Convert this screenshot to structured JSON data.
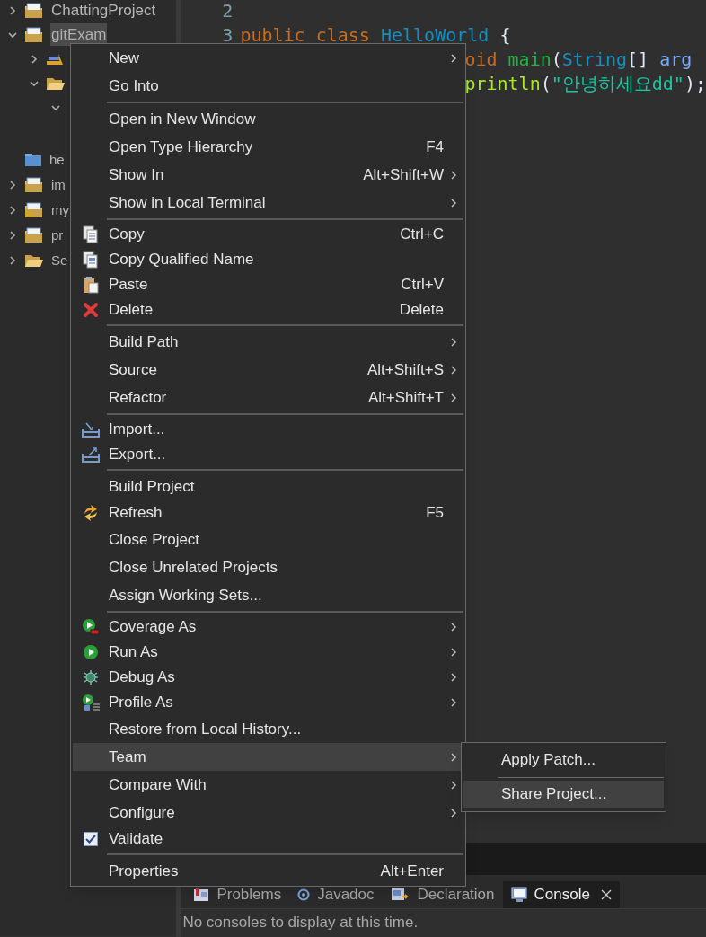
{
  "tree": [
    {
      "label": "ChattingProject",
      "kind": "project",
      "expanded": false,
      "selected": false
    },
    {
      "label": "gitExam",
      "kind": "project",
      "expanded": true,
      "selected": true,
      "children": [
        {
          "kind": "library",
          "expanded": false
        },
        {
          "kind": "folder",
          "expanded": true,
          "children": [
            {
              "expanded": true
            }
          ]
        }
      ]
    },
    {
      "label": "he",
      "kind": "box",
      "selected": false
    },
    {
      "label": "im",
      "kind": "project",
      "expanded": false,
      "selected": false
    },
    {
      "label": "my",
      "kind": "project-locked",
      "expanded": false,
      "selected": false
    },
    {
      "label": "pr",
      "kind": "project",
      "expanded": false,
      "selected": false
    },
    {
      "label": "Se",
      "kind": "folder",
      "expanded": false,
      "selected": false
    }
  ],
  "editor": {
    "lines": [
      {
        "number": "2"
      },
      {
        "number": "3",
        "tokens": [
          {
            "kind": "keyword",
            "text": "public class "
          },
          {
            "kind": "type",
            "text": "HelloWorld"
          },
          {
            "kind": "plain",
            "text": " {"
          }
        ]
      },
      {
        "tokens": [
          {
            "kind": "keyword",
            "text": "oid "
          },
          {
            "kind": "method",
            "text": "main"
          },
          {
            "kind": "plain",
            "text": "("
          },
          {
            "kind": "type",
            "text": "String"
          },
          {
            "kind": "plain",
            "text": "[] "
          },
          {
            "kind": "param",
            "text": "arg"
          }
        ]
      },
      {
        "tokens": [
          {
            "kind": "call",
            "text": "println"
          },
          {
            "kind": "plain",
            "text": "("
          },
          {
            "kind": "string",
            "text": "\"안녕하세요dd\""
          },
          {
            "kind": "plain",
            "text": ");"
          }
        ]
      }
    ]
  },
  "context_menu": {
    "items": [
      {
        "kind": "plain",
        "label": "New",
        "submenu": true,
        "selected": false
      },
      {
        "kind": "plain",
        "label": "Go Into",
        "submenu": false,
        "selected": false
      },
      {
        "kind": "separator"
      },
      {
        "kind": "plain",
        "label": "Open in New Window",
        "submenu": false,
        "selected": false
      },
      {
        "kind": "plain",
        "label": "Open Type Hierarchy",
        "shortcut": "F4",
        "submenu": false,
        "selected": false
      },
      {
        "kind": "plain",
        "label": "Show In",
        "shortcut": "Alt+Shift+W",
        "submenu": true,
        "selected": false
      },
      {
        "kind": "plain",
        "label": "Show in Local Terminal",
        "submenu": true,
        "selected": false
      },
      {
        "kind": "separator"
      },
      {
        "kind": "copy",
        "label": "Copy",
        "shortcut": "Ctrl+C",
        "submenu": false,
        "selected": false
      },
      {
        "kind": "copy-qualified",
        "label": "Copy Qualified Name",
        "submenu": false,
        "selected": false
      },
      {
        "kind": "paste",
        "label": "Paste",
        "shortcut": "Ctrl+V",
        "submenu": false,
        "selected": false
      },
      {
        "kind": "delete",
        "label": "Delete",
        "shortcut": "Delete",
        "submenu": false,
        "selected": false
      },
      {
        "kind": "separator"
      },
      {
        "kind": "plain",
        "label": "Build Path",
        "submenu": true,
        "selected": false
      },
      {
        "kind": "plain",
        "label": "Source",
        "shortcut": "Alt+Shift+S",
        "submenu": true,
        "selected": false
      },
      {
        "kind": "plain",
        "label": "Refactor",
        "shortcut": "Alt+Shift+T",
        "submenu": true,
        "selected": false
      },
      {
        "kind": "separator"
      },
      {
        "kind": "import",
        "label": "Import...",
        "submenu": false,
        "selected": false
      },
      {
        "kind": "export",
        "label": "Export...",
        "submenu": false,
        "selected": false
      },
      {
        "kind": "separator"
      },
      {
        "kind": "plain",
        "label": "Build Project",
        "submenu": false,
        "selected": false
      },
      {
        "kind": "refresh",
        "label": "Refresh",
        "shortcut": "F5",
        "submenu": false,
        "selected": false
      },
      {
        "kind": "plain",
        "label": "Close Project",
        "submenu": false,
        "selected": false
      },
      {
        "kind": "plain",
        "label": "Close Unrelated Projects",
        "submenu": false,
        "selected": false
      },
      {
        "kind": "plain",
        "label": "Assign Working Sets...",
        "submenu": false,
        "selected": false
      },
      {
        "kind": "separator"
      },
      {
        "kind": "coverage",
        "label": "Coverage As",
        "submenu": true,
        "selected": false
      },
      {
        "kind": "run",
        "label": "Run As",
        "submenu": true,
        "selected": false
      },
      {
        "kind": "debug",
        "label": "Debug As",
        "submenu": true,
        "selected": false
      },
      {
        "kind": "profile",
        "label": "Profile As",
        "submenu": true,
        "selected": false
      },
      {
        "kind": "plain",
        "label": "Restore from Local History...",
        "submenu": false,
        "selected": false
      },
      {
        "kind": "plain",
        "label": "Team",
        "submenu": true,
        "selected": true
      },
      {
        "kind": "plain",
        "label": "Compare With",
        "submenu": true,
        "selected": false
      },
      {
        "kind": "plain",
        "label": "Configure",
        "submenu": true,
        "selected": false
      },
      {
        "kind": "check",
        "label": "Validate",
        "checked": true,
        "submenu": false,
        "selected": false
      },
      {
        "kind": "separator"
      },
      {
        "kind": "plain",
        "label": "Properties",
        "shortcut": "Alt+Enter",
        "submenu": false,
        "selected": false
      }
    ]
  },
  "submenu": {
    "items": [
      {
        "kind": "plain",
        "label": "Apply Patch...",
        "selected": false
      },
      {
        "kind": "separator"
      },
      {
        "kind": "plain",
        "label": "Share Project...",
        "selected": true
      }
    ]
  },
  "bottom_panel": {
    "tabs": [
      {
        "label": "Problems",
        "kind": "problems",
        "selected": false,
        "closable": false
      },
      {
        "label": "Javadoc",
        "kind": "javadoc",
        "selected": false,
        "closable": false
      },
      {
        "label": "Declaration",
        "kind": "declaration",
        "selected": false,
        "closable": false
      },
      {
        "label": "Console",
        "kind": "console",
        "selected": true,
        "closable": true
      }
    ],
    "message": "No consoles to display at this time."
  }
}
